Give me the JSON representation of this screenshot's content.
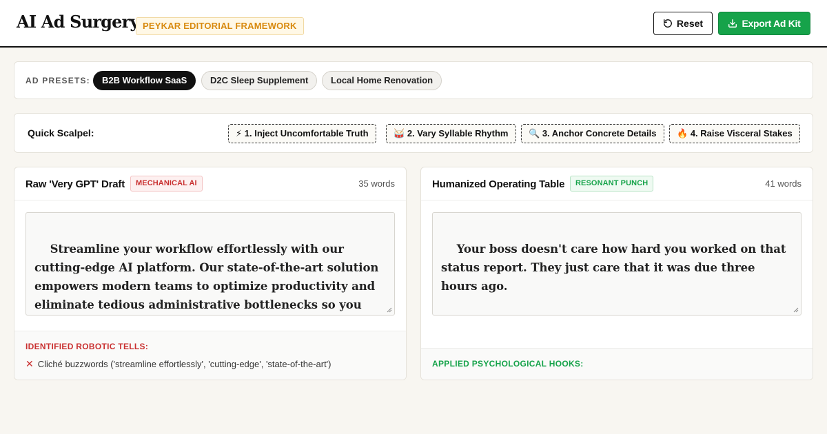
{
  "header": {
    "title": "AI Ad Surgery",
    "badge": "PEYKAR EDITORIAL FRAMEWORK",
    "reset_label": "Reset",
    "export_label": "Export Ad Kit"
  },
  "presets": {
    "label": "AD PRESETS:",
    "items": [
      {
        "label": "B2B Workflow SaaS",
        "active": true
      },
      {
        "label": "D2C Sleep Supplement",
        "active": false
      },
      {
        "label": "Local Home Renovation",
        "active": false
      }
    ]
  },
  "scalpel": {
    "label": "Quick Scalpel:",
    "tools": [
      {
        "icon": "lightning-icon",
        "glyph": "⚡",
        "label": "1. Inject Uncomfortable Truth"
      },
      {
        "icon": "drum-icon",
        "glyph": "🥁",
        "label": "2. Vary Syllable Rhythm"
      },
      {
        "icon": "magnifier-icon",
        "glyph": "🔍",
        "label": "3. Anchor Concrete Details"
      },
      {
        "icon": "fire-icon",
        "glyph": "🔥",
        "label": "4. Raise Visceral Stakes"
      }
    ]
  },
  "raw_panel": {
    "title": "Raw 'Very GPT' Draft",
    "tag": "MECHANICAL AI",
    "word_count": "35 words",
    "text": "Streamline your workflow effortlessly with our cutting-edge AI platform. Our state-of-the-art solution empowers modern teams to optimize productivity and eliminate tedious administrative bottlenecks so you can focus on what truly matters. Experience unparalleled efficiency today.",
    "findings_title": "IDENTIFIED ROBOTIC TELLS:",
    "findings": [
      {
        "mark": "✕",
        "text": "Cliché buzzwords ('streamline effortlessly', 'cutting-edge', 'state-of-the-art')"
      }
    ]
  },
  "human_panel": {
    "title": "Humanized Operating Table",
    "tag": "RESONANT PUNCH",
    "word_count": "41 words",
    "text": "Your boss doesn't care how hard you worked on that status report. They just care that it was due three hours ago.\n\nStop drowning in administrative busywork. Connect your database once, automate the status syncs, and close your",
    "findings_title": "APPLIED PSYCHOLOGICAL HOOKS:"
  },
  "colors": {
    "accent_green": "#16a34a",
    "alert_red": "#c93030",
    "badge_amber": "#d88a0f",
    "background": "#f8f6f1"
  }
}
